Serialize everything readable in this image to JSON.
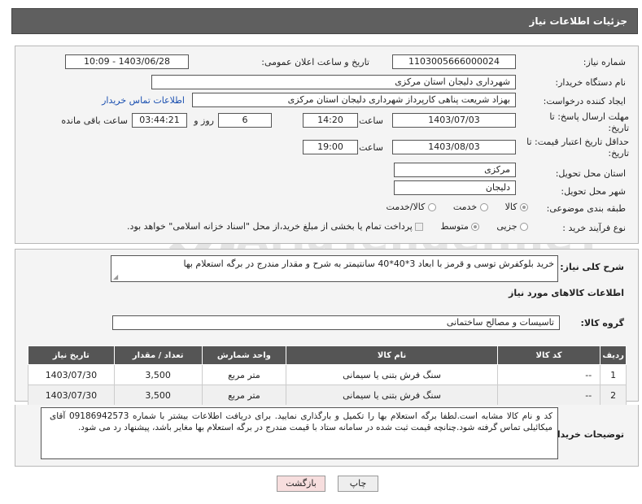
{
  "header": {
    "title": "جزئیات اطلاعات نیاز"
  },
  "form": {
    "need_number_label": "شماره نیاز:",
    "need_number": "1103005666000024",
    "announce_label": "تاریخ و ساعت اعلان عمومی:",
    "announce_value": "1403/06/28 - 10:09",
    "buyer_label": "نام دستگاه خریدار:",
    "buyer_value": "شهرداری دلیجان استان مرکزی",
    "creator_label": "ایجاد کننده درخواست:",
    "creator_value": "بهزاد شریعت پناهی کارپرداز شهرداری دلیجان استان مرکزی",
    "contact_link": "اطلاعات تماس خریدار",
    "deadline_label": "مهلت ارسال پاسخ: تا تاریخ:",
    "deadline_date": "1403/07/03",
    "time_label": "ساعت",
    "deadline_time": "14:20",
    "days_value": "6",
    "days_label": "روز و",
    "remaining_time": "03:44:21",
    "remaining_label": "ساعت باقی مانده",
    "validity_label": "حداقل تاریخ اعتبار قیمت: تا تاریخ:",
    "validity_date": "1403/08/03",
    "validity_time_label": "ساعت",
    "validity_time": "19:00",
    "province_label": "استان محل تحویل:",
    "province_value": "مرکزی",
    "city_label": "شهر محل تحویل:",
    "city_value": "دلیجان",
    "category_label": "طبقه بندی موضوعی:",
    "category_options": [
      "کالا",
      "خدمت",
      "کالا/خدمت"
    ],
    "purchase_label": "نوع فرآیند خرید :",
    "purchase_options": [
      "جزیی",
      "متوسط"
    ],
    "payment_note": "پرداخت تمام یا بخشی از مبلغ خرید،از محل \"اسناد خزانه اسلامی\" خواهد بود."
  },
  "description": {
    "label": "شرح کلی نیاز:",
    "value": "خرید بلوکفرش توسی و قرمز با ابعاد 3*40*40 سانتیمتر به شرح و مقدار مندرج در برگه استعلام بها"
  },
  "goods_section": {
    "title": "اطلاعات کالاهای مورد نیاز",
    "group_label": "گروه کالا:",
    "group_value": "تاسیسات و مصالح ساختمانی"
  },
  "table": {
    "headers": [
      "ردیف",
      "کد کالا",
      "نام کالا",
      "واحد شمارش",
      "تعداد / مقدار",
      "تاریخ نیاز"
    ],
    "rows": [
      [
        "1",
        "--",
        "سنگ فرش بتنی یا سیمانی",
        "متر مربع",
        "3,500",
        "1403/07/30"
      ],
      [
        "2",
        "--",
        "سنگ فرش بتنی یا سیمانی",
        "متر مربع",
        "3,500",
        "1403/07/30"
      ]
    ]
  },
  "buyer_notes": {
    "label": "توضیحات خریدار:",
    "value": "کد و نام کالا مشابه است.لطفا برگه استعلام بها را تکمیل و بارگذاری نمایید. برای دریافت اطلاعات بیشتر با شماره 09186942573 آقای میکائیلی تماس گرفته شود.چنانچه قیمت ثبت شده در سامانه ستاد با قیمت مندرج در برگه استعلام بها مغایر باشد، پیشنهاد رد می شود."
  },
  "buttons": {
    "print": "چاپ",
    "back": "بازگشت"
  },
  "watermark": {
    "text": "AriaTender.neT"
  },
  "colors": {
    "header_bg": "#5f5f5f",
    "link": "#1a4fb0",
    "back_button": "#f7dede",
    "print_button": "#eeeeee",
    "table_header": "#555555"
  }
}
